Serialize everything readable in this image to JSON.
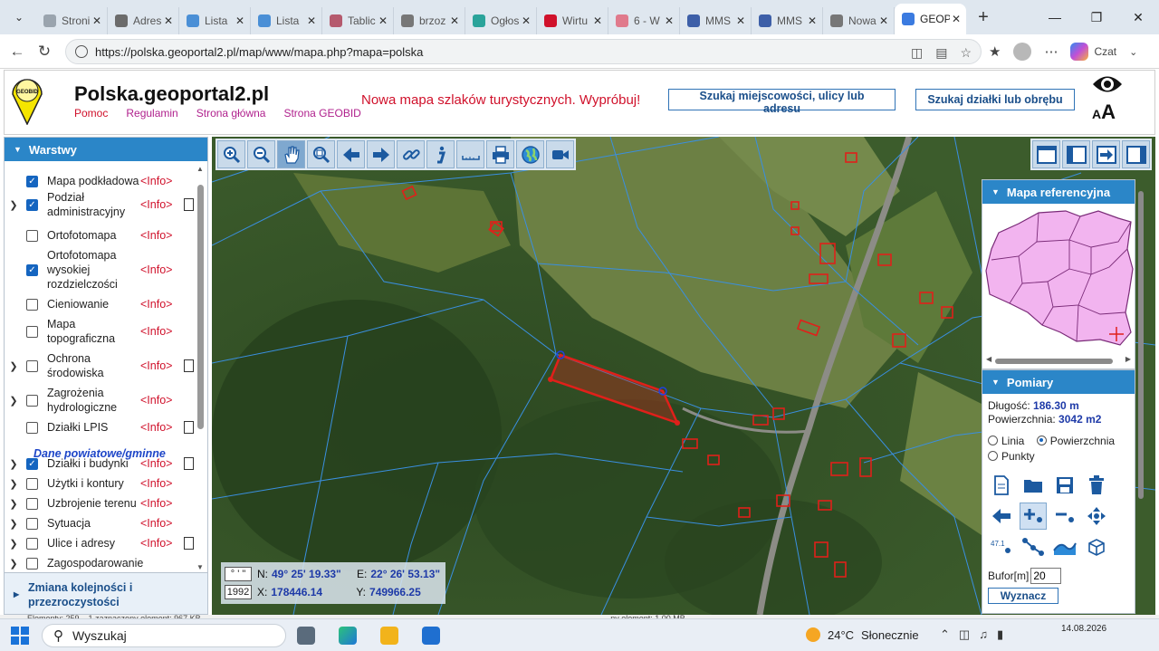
{
  "browser": {
    "tabs": [
      {
        "label": "Stroni",
        "color": "#9aa4ae"
      },
      {
        "label": "Adres",
        "color": "#6b6b6b"
      },
      {
        "label": "Lista",
        "color": "#4a8fd6"
      },
      {
        "label": "Lista",
        "color": "#4a8fd6"
      },
      {
        "label": "Tablic",
        "color": "#b55a6e"
      },
      {
        "label": "brzoz",
        "color": "#777777"
      },
      {
        "label": "Ogłos",
        "color": "#2aa39a"
      },
      {
        "label": "Wirtu",
        "color": "#d0112b"
      },
      {
        "label": "6 - W",
        "color": "#e07a8c"
      },
      {
        "label": "MMS",
        "color": "#3d5fa8"
      },
      {
        "label": "MMS",
        "color": "#3d5fa8"
      },
      {
        "label": "Nowa",
        "color": "#777777"
      },
      {
        "label": "GEOP",
        "color": "#3b7be0",
        "active": true
      }
    ],
    "new_tab": "+",
    "url": "https://polska.geoportal2.pl/map/www/mapa.php?mapa=polska",
    "copilot_label": "Czat"
  },
  "header": {
    "title": "Polska.geoportal2.pl",
    "links": [
      {
        "label": "Pomoc",
        "color": "#d0112b"
      },
      {
        "label": "Regulamin",
        "color": "#b0218d"
      },
      {
        "label": "Strona główna",
        "color": "#b0218d"
      },
      {
        "label": "Strona GEOBID",
        "color": "#b0218d"
      }
    ],
    "promo": "Nowa mapa szlaków turystycznych. Wypróbuj!",
    "search_place": "Szukaj miejscowości, ulicy lub adresu",
    "search_parcel": "Szukaj działki lub obrębu",
    "font_small": "A",
    "font_big": "A",
    "logo_text": "GEOBID"
  },
  "layers": {
    "title": "Warstwy",
    "items": [
      {
        "label": "Mapa podkładowa",
        "checked": true,
        "expander": false,
        "info": "<Info>",
        "doc": false
      },
      {
        "label": "Podział administracyjny",
        "checked": true,
        "expander": true,
        "info": "<Info>",
        "doc": true
      },
      {
        "label": "Ortofotomapa",
        "checked": false,
        "expander": false,
        "info": "<Info>",
        "doc": false
      },
      {
        "label": "Ortofotomapa wysokiej rozdzielczości",
        "checked": true,
        "expander": false,
        "info": "<Info>",
        "doc": false
      },
      {
        "label": "Cieniowanie",
        "checked": false,
        "expander": false,
        "info": "<Info>",
        "doc": false
      },
      {
        "label": "Mapa topograficzna",
        "checked": false,
        "expander": false,
        "info": "<Info>",
        "doc": false
      },
      {
        "label": "Ochrona środowiska",
        "checked": false,
        "expander": true,
        "info": "<Info>",
        "doc": true
      },
      {
        "label": "Zagrożenia hydrologiczne",
        "checked": false,
        "expander": true,
        "info": "<Info>",
        "doc": false
      },
      {
        "label": "Działki LPIS",
        "checked": false,
        "expander": false,
        "info": "<Info>",
        "doc": true
      },
      {
        "label": "Działki i budynki",
        "checked": true,
        "expander": true,
        "info": "<Info>",
        "doc": true
      },
      {
        "label": "Użytki i kontury",
        "checked": false,
        "expander": true,
        "info": "<Info>",
        "doc": false
      },
      {
        "label": "Uzbrojenie terenu",
        "checked": false,
        "expander": true,
        "info": "<Info>",
        "doc": false
      },
      {
        "label": "Sytuacja",
        "checked": false,
        "expander": true,
        "info": "<Info>",
        "doc": false
      },
      {
        "label": "Ulice i adresy",
        "checked": false,
        "expander": true,
        "info": "<Info>",
        "doc": true
      },
      {
        "label": "Zagospodarowanie",
        "checked": false,
        "expander": true,
        "info": "",
        "doc": false
      }
    ],
    "group_label": "Dane powiatowe/gminne",
    "order_link": "Zmiana kolejności i przezroczystości"
  },
  "coords": {
    "format_dms": "° ' \"",
    "format_1992": "1992",
    "n_label": "N:",
    "n_value": "49° 25' 19.33\"",
    "e_label": "E:",
    "e_value": "22° 26' 53.13\"",
    "x_label": "X:",
    "x_value": "178446.14",
    "y_label": "Y:",
    "y_value": "749966.25"
  },
  "reference_map": {
    "title": "Mapa referencyjna"
  },
  "measurements": {
    "title": "Pomiary",
    "length_label": "Długość:",
    "length_value": "186.30 m",
    "area_label": "Powierzchnia:",
    "area_value": "3042 m2",
    "mode_line": "Linia",
    "mode_area": "Powierzchnia",
    "mode_points": "Punkty",
    "selected_mode": "Powierzchnia",
    "buffer_label": "Bufor[m]",
    "buffer_value": "20",
    "compute_button": "Wyznacz",
    "small_label": "47.1"
  },
  "status": {
    "text": "Elementy: 259    1 zaznaczony element: 967 KB                                                                                                                                                                                     ny element: 1,00 MB"
  },
  "taskbar": {
    "search_placeholder": "Wyszukaj",
    "temperature": "24°C",
    "weather": "Słonecznie",
    "date": "14.08.2026"
  },
  "colors": {
    "accent": "#2b86c8",
    "parcel_outline": "#3a8fe0",
    "selection": "#e0201a",
    "info": "#d0112b"
  }
}
